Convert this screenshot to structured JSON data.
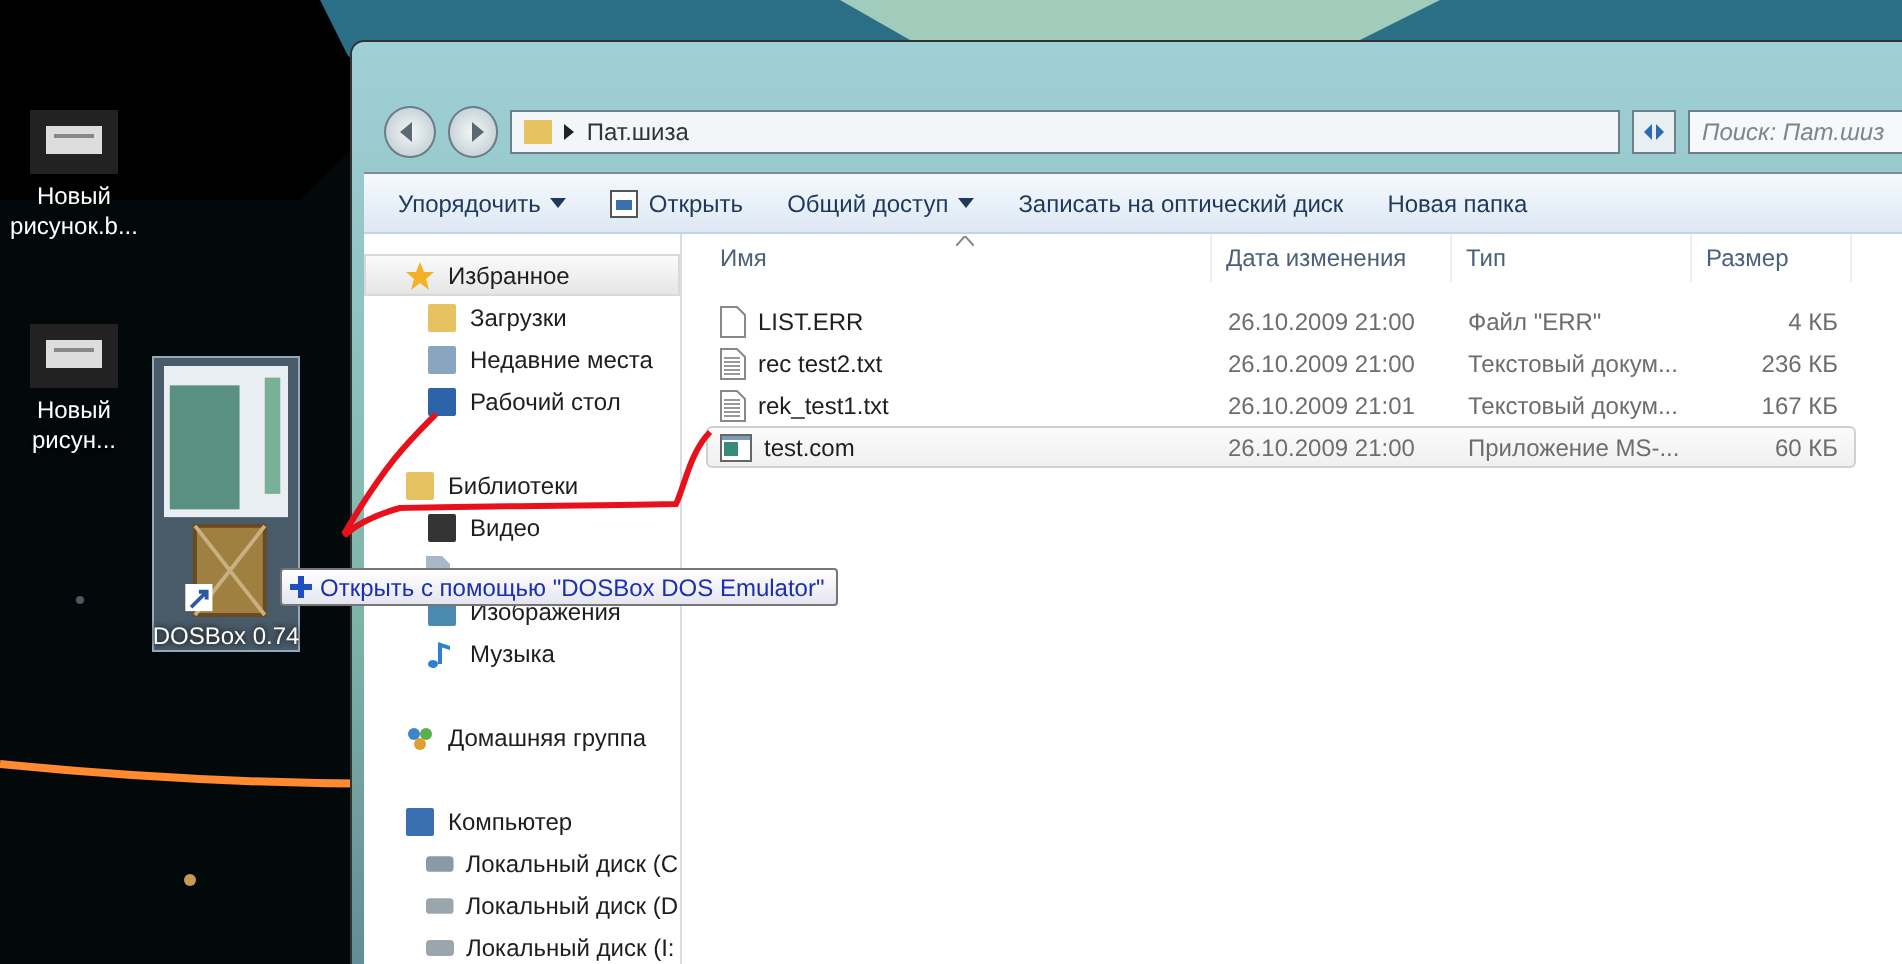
{
  "desktop": {
    "icons": [
      {
        "label": "Новый рисунок.b..."
      },
      {
        "label": "Новый рисун..."
      }
    ],
    "drag": {
      "label": "DOSBox 0.74",
      "tooltip": "Открыть с помощью \"DOSBox DOS Emulator\""
    }
  },
  "explorer": {
    "path": "Пат.шиза",
    "search": {
      "placeholder": "Поиск: Пат.шиз"
    },
    "toolbar": [
      {
        "label": "Упорядочить",
        "kind": "menu"
      },
      {
        "label": "Открыть",
        "kind": "open"
      },
      {
        "label": "Общий доступ",
        "kind": "menu"
      },
      {
        "label": "Записать на оптический диск",
        "kind": "plain"
      },
      {
        "label": "Новая папка",
        "kind": "plain"
      }
    ],
    "nav": [
      {
        "label": "Избранное",
        "highlighted": true,
        "children": [
          {
            "label": "Загрузки"
          },
          {
            "label": "Недавние места"
          },
          {
            "label": "Рабочий стол"
          }
        ]
      },
      {
        "label": "Библиотеки",
        "highlighted": false,
        "children": [
          {
            "label": "Видео"
          },
          {
            "kind": "icon-only"
          },
          {
            "label": "Изображения"
          },
          {
            "label": "Музыка"
          }
        ]
      },
      {
        "label": "Домашняя группа",
        "highlighted": false
      },
      {
        "label": "Компьютер",
        "highlighted": false,
        "children": [
          {
            "label": "Локальный диск (C"
          },
          {
            "label": "Локальный диск (D"
          },
          {
            "label": "Локальный диск (I:"
          }
        ]
      }
    ],
    "columns": [
      "Имя",
      "Дата изменения",
      "Тип",
      "Размер"
    ],
    "files": [
      {
        "name": "LIST.ERR",
        "kind": "blank",
        "date": "26.10.2009 21:00",
        "type": "Файл \"ERR\"",
        "size": "4 КБ",
        "selected": false
      },
      {
        "name": "rec test2.txt",
        "kind": "text",
        "date": "26.10.2009 21:00",
        "type": "Текстовый докум...",
        "size": "236 КБ",
        "selected": false
      },
      {
        "name": "rek_test1.txt",
        "kind": "text",
        "date": "26.10.2009 21:01",
        "type": "Текстовый докум...",
        "size": "167 КБ",
        "selected": false
      },
      {
        "name": "test.com",
        "kind": "app",
        "date": "26.10.2009 21:00",
        "type": "Приложение MS-...",
        "size": "60 КБ",
        "selected": true
      }
    ]
  }
}
